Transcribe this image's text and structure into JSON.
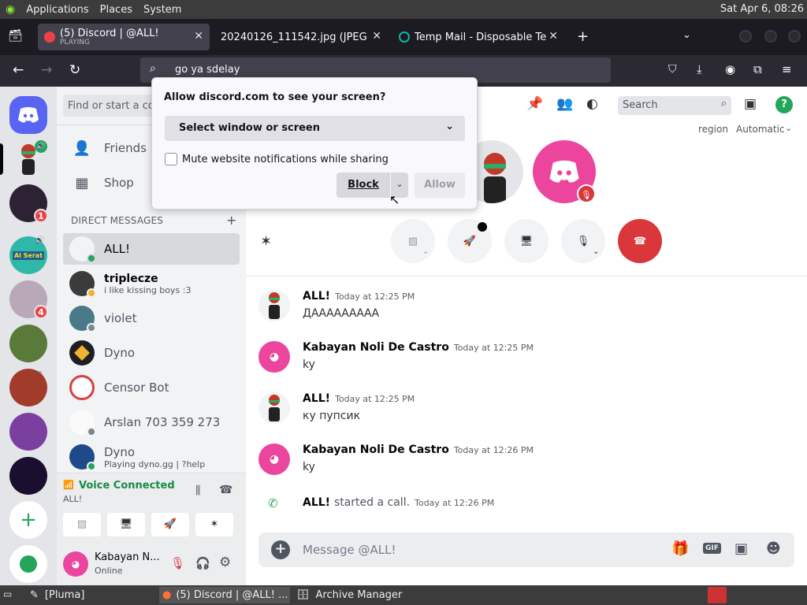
{
  "system_panel": {
    "menus": [
      "Applications",
      "Places",
      "System"
    ],
    "clock": "Sat Apr  6, 08:26"
  },
  "browser": {
    "tabs": [
      {
        "title": "(5) Discord | @ALL!",
        "subtitle": "PLAYING"
      },
      {
        "title": "20240126_111542.jpg (JPEG Ima"
      },
      {
        "title": "Temp Mail - Disposable Tem"
      }
    ],
    "url": "go ya sdelay"
  },
  "share_dialog": {
    "title": "Allow discord.com to see your screen?",
    "select_label": "Select window or screen",
    "mute_label": "Mute website notifications while sharing",
    "block_label": "Block",
    "allow_label": "Allow"
  },
  "servers": {
    "badges": [
      "1",
      "4"
    ],
    "sign_badge": "Al Serat"
  },
  "dm_pane": {
    "search_placeholder": "Find or start a co",
    "friends_label": "Friends",
    "shop_label": "Shop",
    "section_title": "DIRECT MESSAGES",
    "dms": [
      {
        "name": "ALL!",
        "status_text": ""
      },
      {
        "name": "triplecze",
        "status_text": "i like kissing boys :3"
      },
      {
        "name": "violet",
        "status_text": ""
      },
      {
        "name": "Dyno",
        "status_text": ""
      },
      {
        "name": "Censor Bot",
        "status_text": ""
      },
      {
        "name": "Arslan 703 359 273",
        "status_text": ""
      },
      {
        "name": "Dyno",
        "status_text": "Playing dyno.gg | ?help"
      }
    ],
    "voice": {
      "status": "Voice Connected",
      "channel": "ALL!"
    },
    "user": {
      "name": "Kabayan N...",
      "status": "Online"
    }
  },
  "header": {
    "search_placeholder": "Search",
    "region_label": "region",
    "region_value": "Automatic"
  },
  "messages": [
    {
      "author": "ALL!",
      "time": "Today at 12:25 PM",
      "text": "ДААААААААА"
    },
    {
      "author": "Kabayan Noli De Castro",
      "time": "Today at 12:25 PM",
      "text": "ky"
    },
    {
      "author": "ALL!",
      "time": "Today at 12:25 PM",
      "text": "ку пупсик"
    },
    {
      "author": "Kabayan Noli De Castro",
      "time": "Today at 12:26 PM",
      "text": "ky"
    }
  ],
  "call_event": {
    "author": "ALL!",
    "text": "started a call.",
    "time": "Today at 12:26 PM"
  },
  "composer": {
    "placeholder": "Message @ALL!",
    "gif_label": "GIF"
  },
  "taskbar": {
    "tasks": [
      "[Pluma]",
      "(5) Discord | @ALL! ...",
      "Archive Manager"
    ]
  },
  "colors": {
    "brand": "#5865f2",
    "pink": "#eb459e",
    "danger": "#da373c",
    "online": "#23a55a"
  }
}
